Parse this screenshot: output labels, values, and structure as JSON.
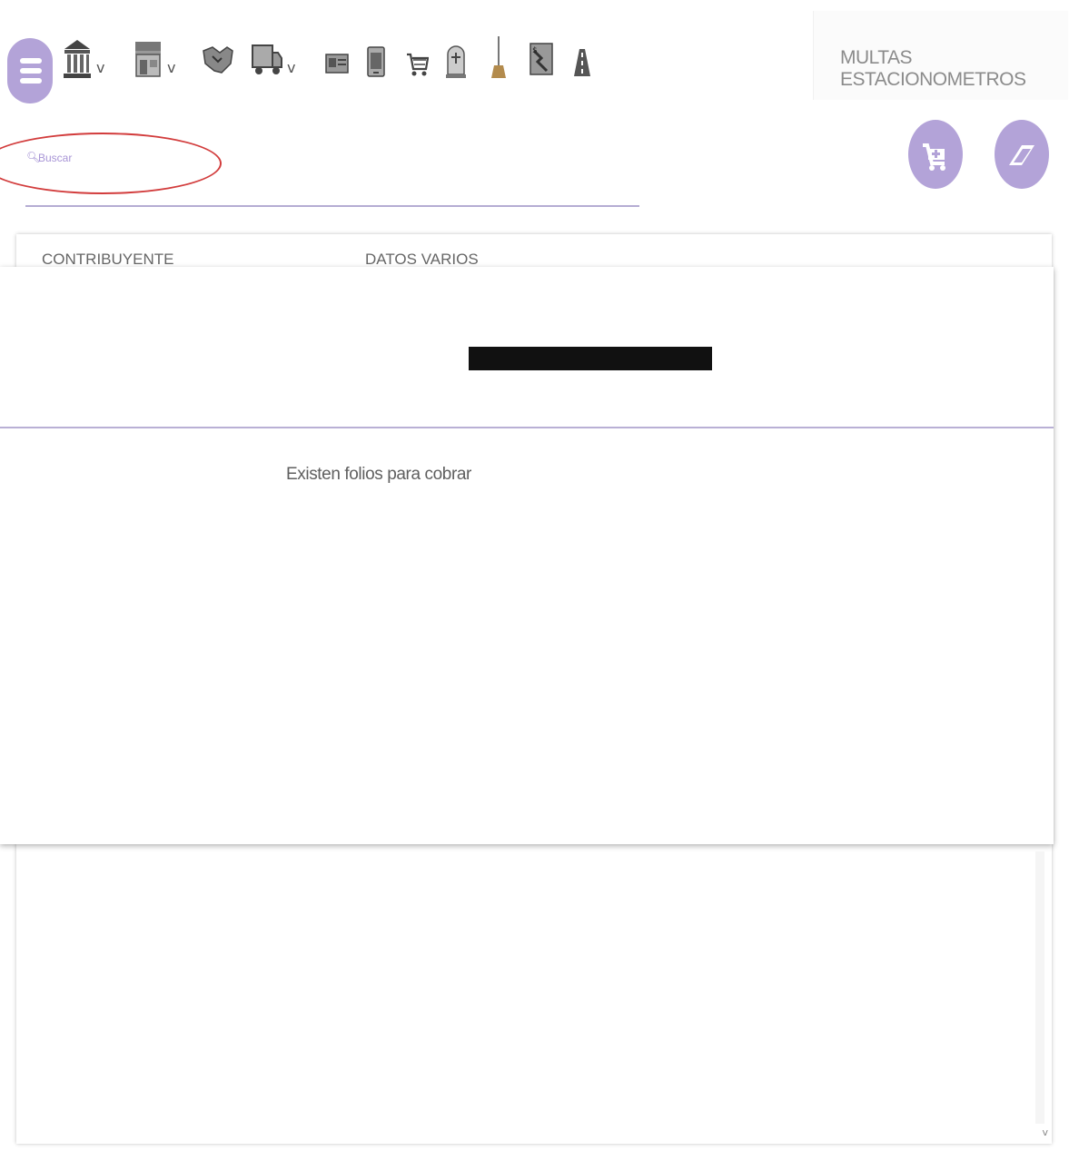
{
  "toolbar": {
    "icons": [
      {
        "name": "government-building-icon",
        "has_dropdown": true
      },
      {
        "name": "storefront-icon",
        "has_dropdown": true
      },
      {
        "name": "handshake-icon",
        "has_dropdown": false
      },
      {
        "name": "truck-icon",
        "has_dropdown": true
      },
      {
        "name": "id-card-icon",
        "has_dropdown": false
      },
      {
        "name": "phone-document-icon",
        "has_dropdown": false
      },
      {
        "name": "shopping-cart-icon",
        "has_dropdown": false
      },
      {
        "name": "tombstone-icon",
        "has_dropdown": false
      },
      {
        "name": "broom-icon",
        "has_dropdown": false
      },
      {
        "name": "fine-receipt-icon",
        "has_dropdown": false
      },
      {
        "name": "road-icon",
        "has_dropdown": false
      }
    ],
    "dropdown_glyph": "v"
  },
  "section_title": "MULTAS ESTACIONOMETROS",
  "search": {
    "placeholder": "Buscar",
    "value": ""
  },
  "actions": {
    "add_to_cart": "add-cart-icon",
    "clear": "eraser-icon"
  },
  "table": {
    "columns": [
      "CONTRIBUYENTE",
      "DATOS VARIOS"
    ]
  },
  "modal": {
    "message": "Existen folios para cobrar"
  },
  "colors": {
    "accent": "#b3a3d8",
    "accent_text": "#9a86cf",
    "annotation": "#d23c3c",
    "redaction": "#111111"
  }
}
